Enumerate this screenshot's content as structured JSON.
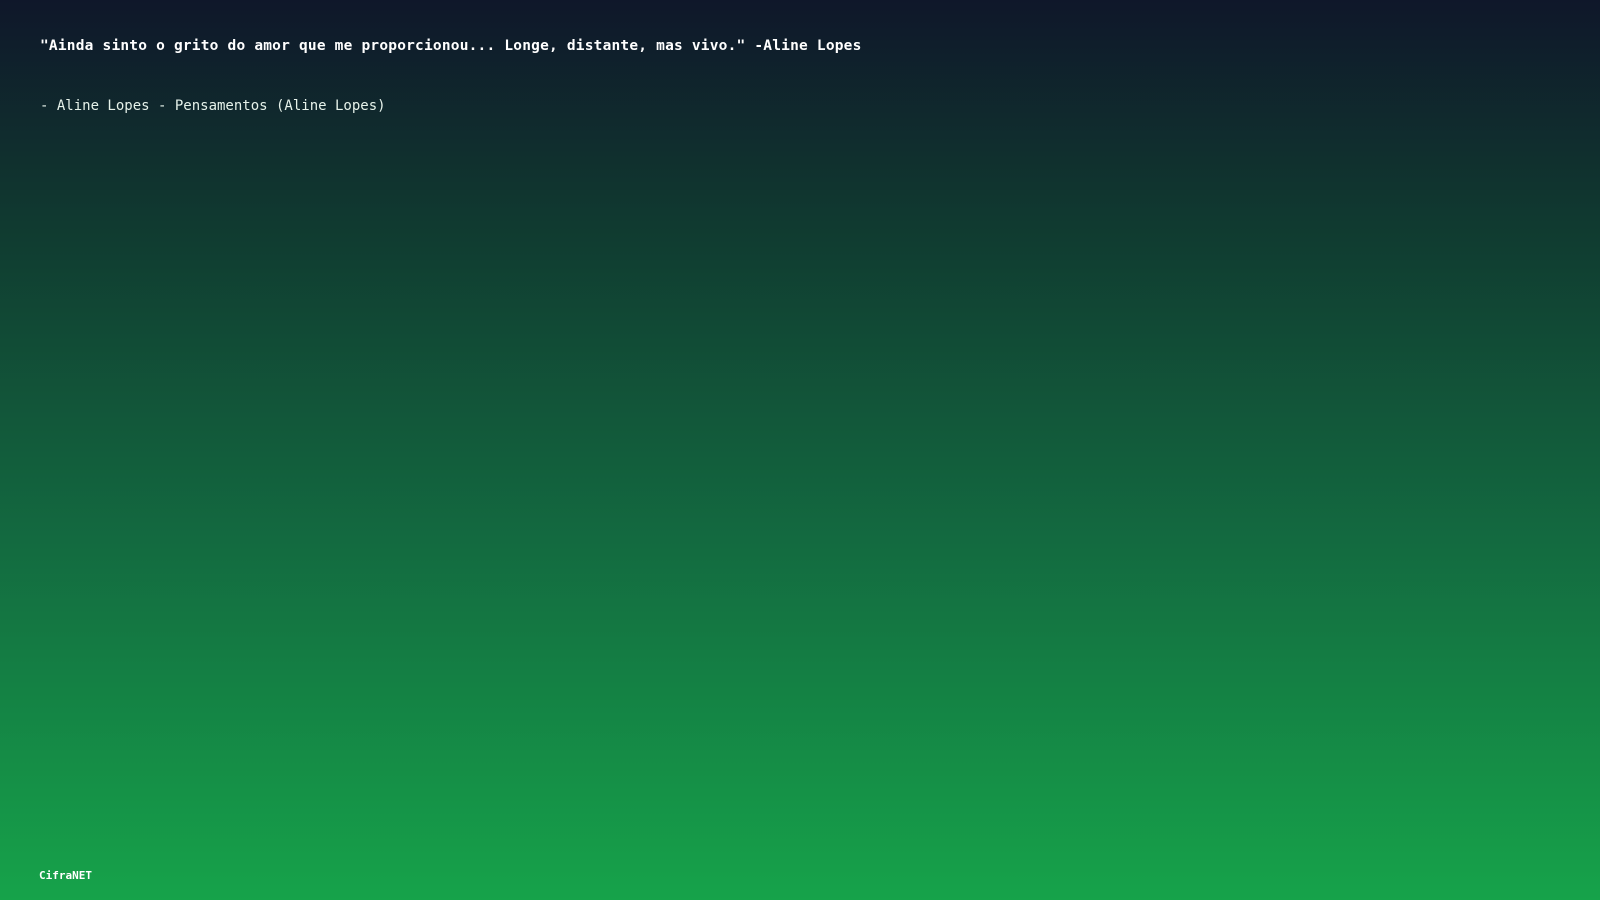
{
  "quote": {
    "text": "\"Ainda sinto o grito do amor que me proporcionou... Longe, distante, mas vivo.\" -Aline Lopes"
  },
  "attribution": {
    "text": "- Aline Lopes - Pensamentos (Aline Lopes)"
  },
  "footer": {
    "brand": "CifraNET"
  }
}
